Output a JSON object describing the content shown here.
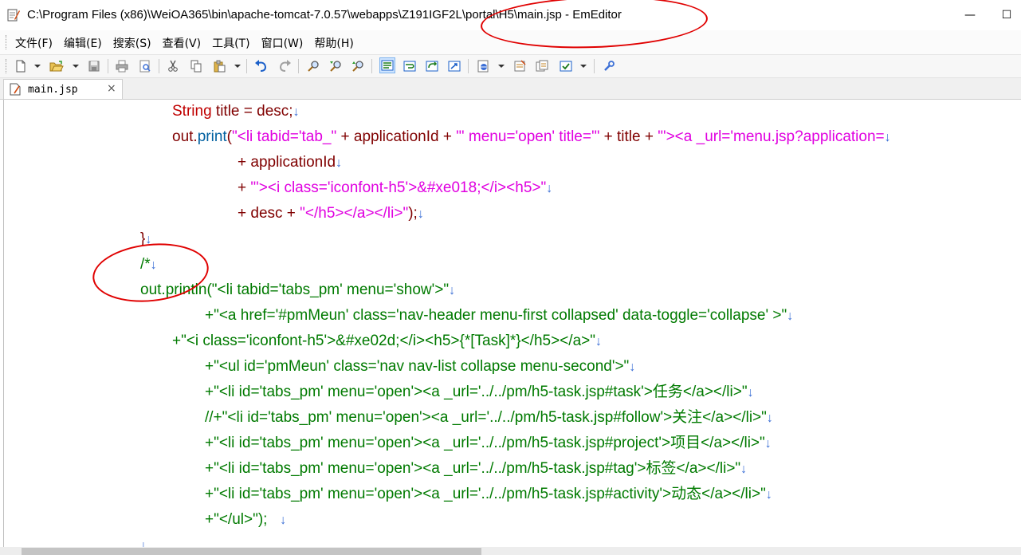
{
  "window": {
    "title": "C:\\Program Files (x86)\\WeiOA365\\bin\\apache-tomcat-7.0.57\\webapps\\Z191IGF2L\\portal\\H5\\main.jsp - EmEditor",
    "minimize_glyph": "—",
    "maximize_glyph": "☐"
  },
  "menu": {
    "items": [
      {
        "label": "文件(F)"
      },
      {
        "label": "编辑(E)"
      },
      {
        "label": "搜索(S)"
      },
      {
        "label": "查看(V)"
      },
      {
        "label": "工具(T)"
      },
      {
        "label": "窗口(W)"
      },
      {
        "label": "帮助(H)"
      }
    ]
  },
  "toolbar": {
    "buttons": [
      {
        "icon": "new-file-icon"
      },
      {
        "icon": "open-folder-icon"
      },
      {
        "icon": "save-icon"
      },
      {
        "icon": "print-icon"
      },
      {
        "icon": "print-preview-icon"
      },
      {
        "icon": "cut-icon"
      },
      {
        "icon": "copy-icon"
      },
      {
        "icon": "paste-icon"
      },
      {
        "icon": "undo-icon"
      },
      {
        "icon": "redo-icon"
      },
      {
        "icon": "find-icon"
      },
      {
        "icon": "find-next-icon"
      },
      {
        "icon": "find-prev-icon"
      },
      {
        "icon": "word-wrap-icon"
      },
      {
        "icon": "wrap-window-icon"
      },
      {
        "icon": "wrap-page-icon"
      },
      {
        "icon": "wrap-chars-icon"
      },
      {
        "icon": "encoding-icon"
      },
      {
        "icon": "properties-icon"
      },
      {
        "icon": "all-properties-icon"
      },
      {
        "icon": "config-icon"
      },
      {
        "icon": "tools-icon"
      }
    ]
  },
  "tab": {
    "label": "main.jsp",
    "close_glyph": "×"
  },
  "editor": {
    "newline_glyph": "↓",
    "lines": [
      {
        "segments": [
          {
            "t": "String",
            "c": "kw"
          },
          {
            "t": " title = desc;",
            "c": "id"
          }
        ]
      },
      {
        "segments": [
          {
            "t": "out.",
            "c": "id"
          },
          {
            "t": "print",
            "c": "fn"
          },
          {
            "t": "(",
            "c": "id"
          },
          {
            "t": "\"<li tabid='tab_\"",
            "c": "str"
          },
          {
            "t": " + applicationId + ",
            "c": "id"
          },
          {
            "t": "\"' menu='open' title='\"",
            "c": "str"
          },
          {
            "t": " + title + ",
            "c": "id"
          },
          {
            "t": "\"'><a _url='menu.jsp?application=",
            "c": "str"
          }
        ]
      },
      {
        "segments": [
          {
            "t": "+ applicationId",
            "c": "id"
          }
        ]
      },
      {
        "segments": [
          {
            "t": "+ ",
            "c": "id"
          },
          {
            "t": "\"'><i class='iconfont-h5'>&#xe018;</i><h5>\"",
            "c": "str"
          }
        ]
      },
      {
        "segments": [
          {
            "t": "+ desc + ",
            "c": "id"
          },
          {
            "t": "\"</h5></a></li>\"",
            "c": "str"
          },
          {
            "t": ");",
            "c": "id"
          }
        ]
      },
      {
        "segments": [
          {
            "t": "}",
            "c": "id"
          }
        ]
      },
      {
        "segments": [
          {
            "t": "/*",
            "c": "cm"
          }
        ]
      },
      {
        "segments": [
          {
            "t": "out.println(\"<li tabid='tabs_pm' menu='show'>\"",
            "c": "cm"
          }
        ]
      },
      {
        "segments": [
          {
            "t": "+\"<a href='#pmMeun' class='nav-header menu-first collapsed' data-toggle='collapse' >\"",
            "c": "cm"
          }
        ]
      },
      {
        "segments": [
          {
            "t": "+\"<i class='iconfont-h5'>&#xe02d;</i><h5>{*[Task]*}</h5></a>\"",
            "c": "cm"
          }
        ]
      },
      {
        "segments": [
          {
            "t": "+\"<ul id='pmMeun' class='nav nav-list collapse menu-second'>\"",
            "c": "cm"
          }
        ]
      },
      {
        "segments": [
          {
            "t": "+\"<li id='tabs_pm' menu='open'><a _url='../../pm/h5-task.jsp#task'>任务</a></li>\"",
            "c": "cm"
          }
        ]
      },
      {
        "segments": [
          {
            "t": "//+\"<li id='tabs_pm' menu='open'><a _url='../../pm/h5-task.jsp#follow'>关注</a></li>\"",
            "c": "cm"
          }
        ]
      },
      {
        "segments": [
          {
            "t": "+\"<li id='tabs_pm' menu='open'><a _url='../../pm/h5-task.jsp#project'>项目</a></li>\"",
            "c": "cm"
          }
        ]
      },
      {
        "segments": [
          {
            "t": "+\"<li id='tabs_pm' menu='open'><a _url='../../pm/h5-task.jsp#tag'>标签</a></li>\"",
            "c": "cm"
          }
        ]
      },
      {
        "segments": [
          {
            "t": "+\"<li id='tabs_pm' menu='open'><a _url='../../pm/h5-task.jsp#activity'>动态</a></li>\"",
            "c": "cm"
          }
        ]
      },
      {
        "segments": [
          {
            "t": "+\"</ul>\");   ",
            "c": "cm"
          }
        ]
      },
      {
        "segments": []
      }
    ]
  }
}
